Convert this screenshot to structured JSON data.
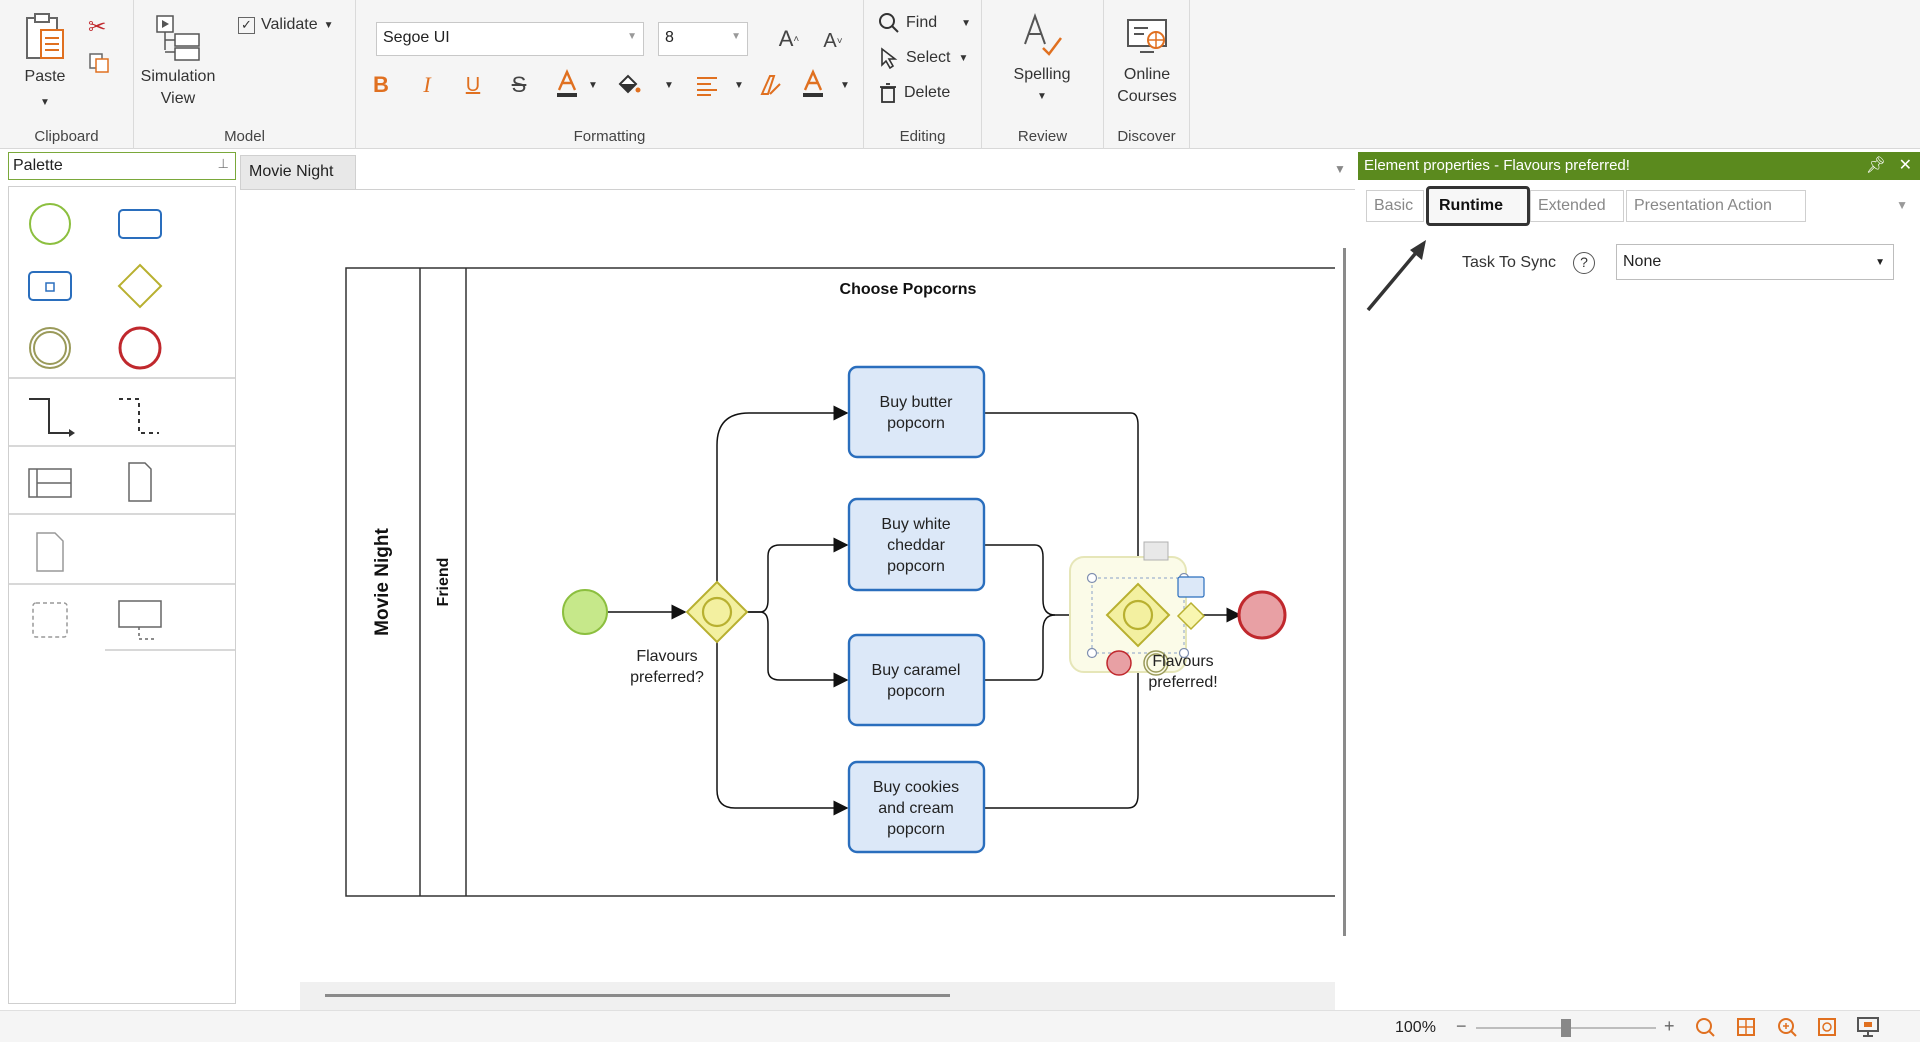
{
  "ribbon": {
    "clipboard": {
      "label": "Clipboard",
      "paste": "Paste"
    },
    "model": {
      "label": "Model",
      "simulation_view_1": "Simulation",
      "simulation_view_2": "View",
      "validate": "Validate"
    },
    "formatting": {
      "label": "Formatting",
      "font": "Segoe UI",
      "size": "8",
      "bold": "B",
      "italic": "I",
      "underline": "U",
      "strike": "S",
      "grow": "A",
      "shrink": "A"
    },
    "editing": {
      "label": "Editing",
      "find": "Find",
      "select": "Select",
      "delete": "Delete"
    },
    "review": {
      "label": "Review",
      "spelling": "Spelling"
    },
    "discover": {
      "label": "Discover",
      "online_1": "Online",
      "online_2": "Courses"
    }
  },
  "palette": {
    "title": "Palette"
  },
  "document": {
    "tab": "Movie Night"
  },
  "diagram": {
    "pool_label": "Movie Night",
    "lane_label": "Friend",
    "subprocess_title": "Choose Popcorns",
    "gateway_split_label_1": "Flavours",
    "gateway_split_label_2": "preferred?",
    "gateway_join_label_1": "Flavours",
    "gateway_join_label_2": "preferred!",
    "tasks": [
      {
        "lines": [
          "Buy butter",
          "popcorn"
        ]
      },
      {
        "lines": [
          "Buy white",
          "cheddar",
          "popcorn"
        ]
      },
      {
        "lines": [
          "Buy caramel",
          "popcorn"
        ]
      },
      {
        "lines": [
          "Buy cookies",
          "and cream",
          "popcorn"
        ]
      }
    ],
    "colors": {
      "start": "#c6e88a",
      "start_stroke": "#8cbf3f",
      "end": "#e8a0a4",
      "end_stroke": "#c0282d",
      "gateway": "#f3f0a0",
      "gateway_stroke": "#b8b030",
      "task": "#dce8f8",
      "task_stroke": "#2a6ebd"
    }
  },
  "properties": {
    "title": "Element properties - Flavours preferred!",
    "tabs": [
      "Basic",
      "Runtime",
      "Extended",
      "Presentation Action"
    ],
    "active_tab": "Runtime",
    "task_to_sync_label": "Task To Sync",
    "task_to_sync_value": "None"
  },
  "status": {
    "zoom": "100%"
  }
}
